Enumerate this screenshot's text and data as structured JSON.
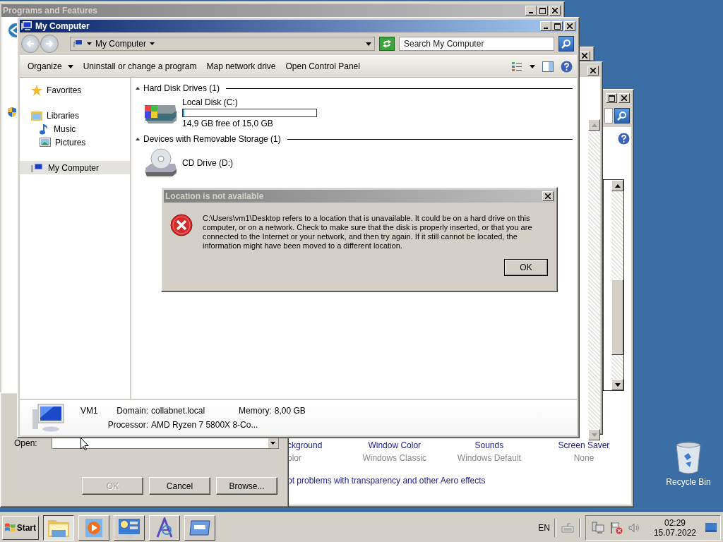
{
  "programs_window": {
    "title": "Programs and Features"
  },
  "personalization": {
    "settings": [
      {
        "label": "ckground",
        "value": "olor"
      },
      {
        "label": "Window Color",
        "value": "Windows Classic"
      },
      {
        "label": "Sounds",
        "value": "Windows Default"
      },
      {
        "label": "Screen Saver",
        "value": "None"
      }
    ],
    "aero_link": "ot problems with transparency and other Aero effects"
  },
  "run_dialog": {
    "open_label": "Open:",
    "buttons": [
      {
        "label": "OK",
        "disabled": true
      },
      {
        "label": "Cancel",
        "disabled": false
      },
      {
        "label": "Browse...",
        "disabled": false
      }
    ]
  },
  "explorer": {
    "title": "My Computer",
    "address": "My Computer",
    "search": {
      "placeholder": "Search My Computer"
    },
    "toolbar": [
      {
        "label": "Organize",
        "dropdown": true
      },
      {
        "label": "Uninstall or change a program",
        "dropdown": false
      },
      {
        "label": "Map network drive",
        "dropdown": false
      },
      {
        "label": "Open Control Panel",
        "dropdown": false
      }
    ],
    "nav": [
      {
        "label": "Favorites",
        "kind": "favorites",
        "selected": false
      },
      {
        "label": "Libraries",
        "kind": "libraries",
        "selected": false,
        "children": [
          {
            "label": "Music",
            "kind": "music",
            "selected": false
          },
          {
            "label": "Pictures",
            "kind": "pictures",
            "selected": false
          }
        ]
      },
      {
        "label": "My Computer",
        "kind": "computer",
        "selected": true
      }
    ],
    "groups": [
      {
        "title": "Hard Disk Drives (1)",
        "expanded": true,
        "items": [
          {
            "name": "Local Disk (C:)",
            "kind": "hdd",
            "level": 0.01,
            "space": "14,9 GB free of 15,0 GB"
          }
        ]
      },
      {
        "title": "Devices with Removable Storage (1)",
        "expanded": true,
        "items": [
          {
            "name": "CD Drive (D:)",
            "kind": "cd"
          }
        ]
      }
    ],
    "details": {
      "name": "VM1",
      "fields": [
        {
          "label": "Domain:",
          "value": "collabnet.local"
        },
        {
          "label": "Memory:",
          "value": "8,00 GB"
        },
        {
          "label": "Processor:",
          "value": "AMD Ryzen 7 5800X 8-Co..."
        }
      ]
    }
  },
  "error_dialog": {
    "title": "Location is not available",
    "message": "C:\\Users\\vm1\\Desktop refers to a location that is unavailable. It could be on a hard drive on this computer, or on a network. Check to make sure that the disk is properly inserted, or that you are connected to the Internet or your network, and then try again. If it still cannot be located, the information might have been moved to a different location.",
    "button": "OK"
  },
  "desktop_icons": [
    {
      "label": "Recycle Bin"
    }
  ],
  "taskbar": {
    "start": "Start",
    "buttons": [
      {
        "kind": "explorer",
        "selected": true
      },
      {
        "kind": "media",
        "selected": false
      },
      {
        "kind": "control_panel",
        "selected": false
      },
      {
        "kind": "font",
        "selected": false
      },
      {
        "kind": "window",
        "selected": false
      }
    ],
    "language": "EN",
    "time": "02:29",
    "date": "15.07.2022"
  }
}
